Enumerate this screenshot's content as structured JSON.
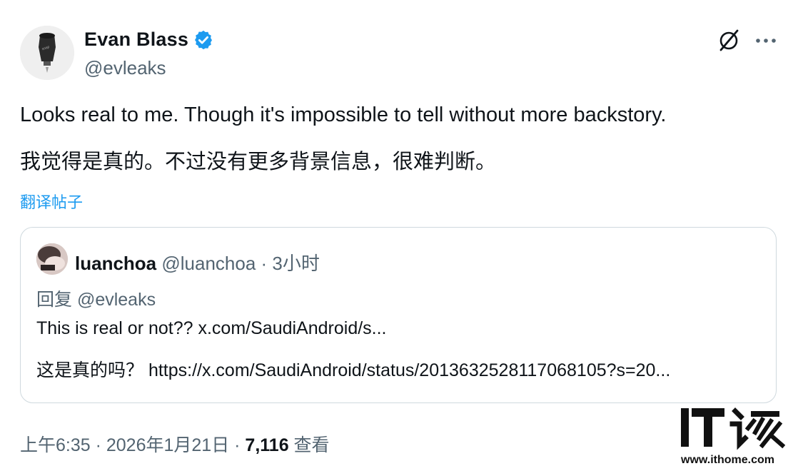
{
  "author": {
    "name": "Evan Blass",
    "handle": "@evleaks"
  },
  "tweet": {
    "text_en": "Looks real to me. Though it's impossible to tell without more backstory.",
    "text_zh": "我觉得是真的。不过没有更多背景信息，很难判断。",
    "translate_label": "翻译帖子"
  },
  "quoted": {
    "name": "luanchoa",
    "meta": "@luanchoa · 3小时",
    "reply_to": "回复 @evleaks",
    "text_en": "This is real or not?? x.com/SaudiAndroid/s...",
    "text_zh": "这是真的吗？ https://x.com/SaudiAndroid/status/2013632528117068105?s=20..."
  },
  "footer": {
    "time_date": "上午6:35 · 2026年1月21日 · ",
    "views_count": "7,116",
    "views_label": " 查看"
  },
  "watermark": {
    "logo_text": "IT之家",
    "url": "www.ithome.com"
  },
  "colors": {
    "link": "#1d9bf0",
    "secondary_text": "#536471",
    "border": "#cfd9de"
  },
  "icons": [
    "verified-badge-icon",
    "grok-icon",
    "more-icon"
  ]
}
